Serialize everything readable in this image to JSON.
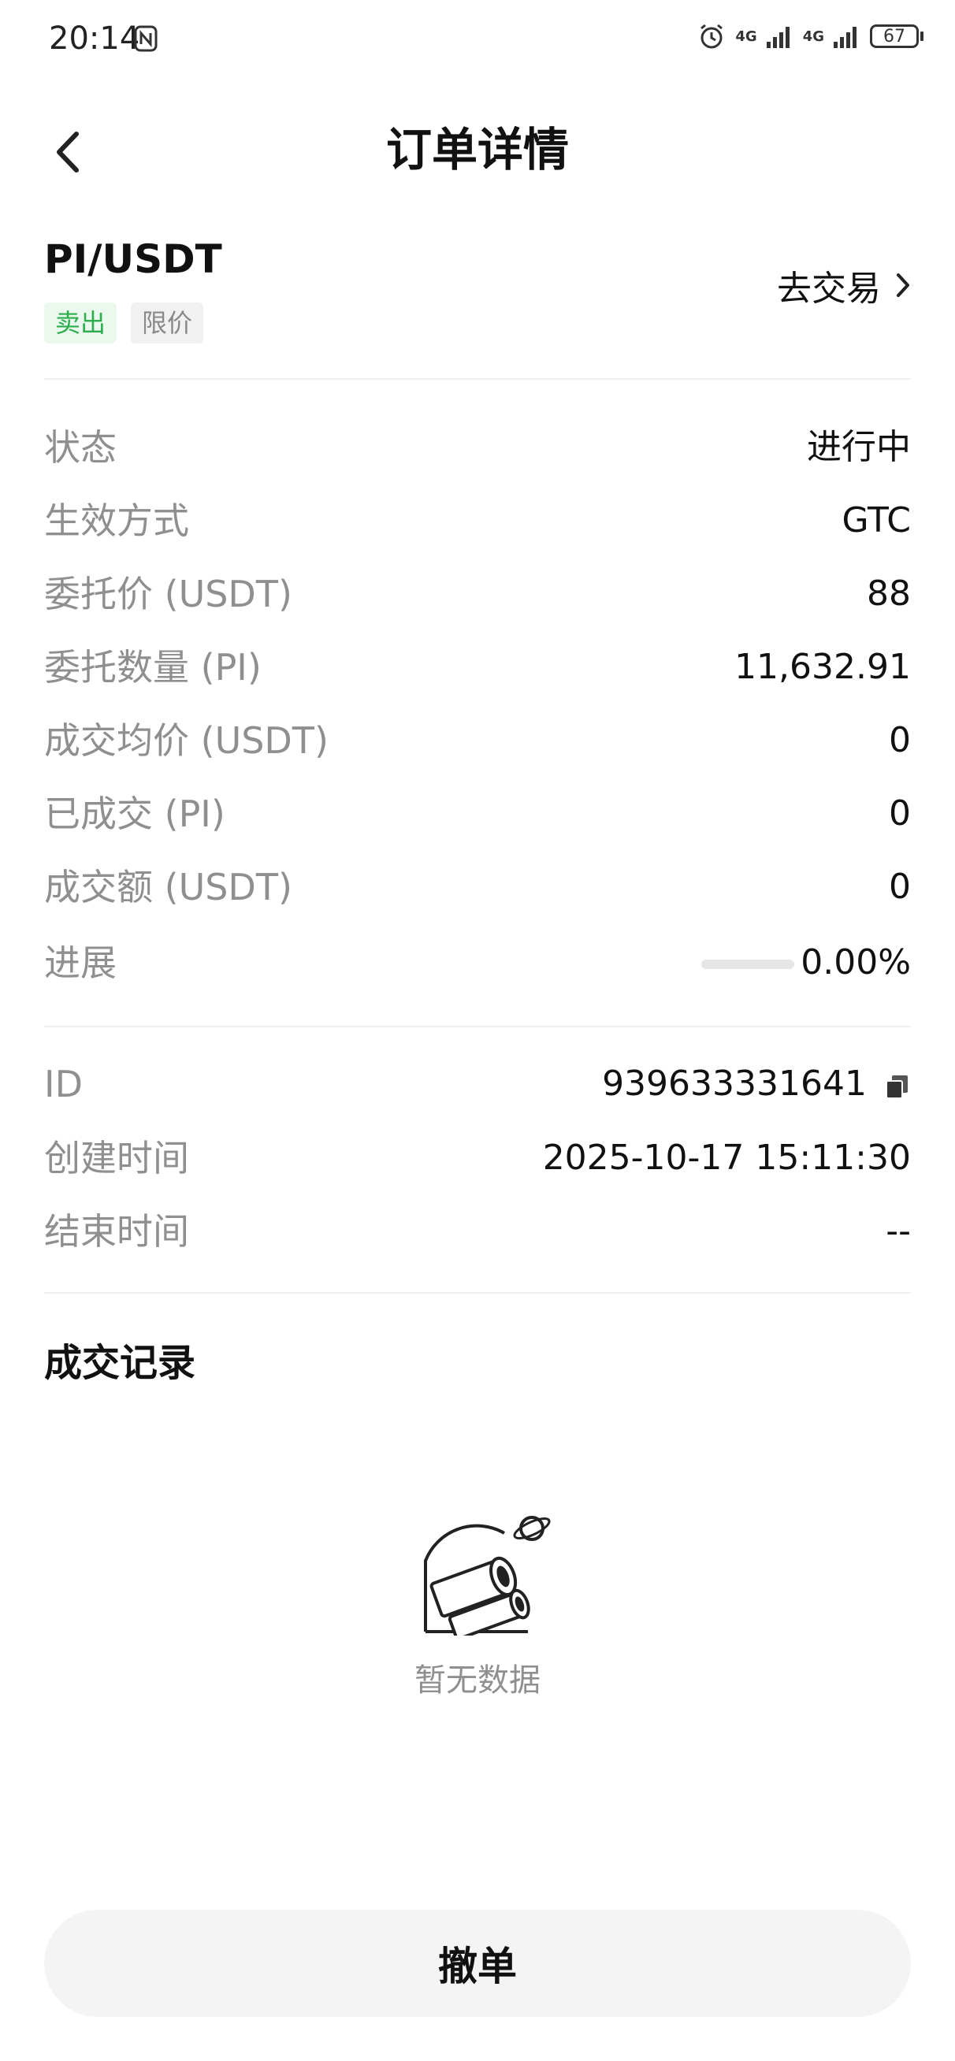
{
  "status_bar": {
    "time": "20:14",
    "network_1": "4G",
    "network_2": "4G",
    "battery": "67"
  },
  "header": {
    "title": "订单详情"
  },
  "order": {
    "pair": "PI/USDT",
    "side_tag": "卖出",
    "type_tag": "限价",
    "trade_link": "去交易"
  },
  "details": [
    {
      "label": "状态",
      "value": "进行中"
    },
    {
      "label": "生效方式",
      "value": "GTC"
    },
    {
      "label": "委托价 (USDT)",
      "value": "88"
    },
    {
      "label": "委托数量 (PI)",
      "value": "11,632.91"
    },
    {
      "label": "成交均价 (USDT)",
      "value": "0"
    },
    {
      "label": "已成交 (PI)",
      "value": "0"
    },
    {
      "label": "成交额 (USDT)",
      "value": "0"
    },
    {
      "label": "进展",
      "value": "0.00%",
      "progress": 0.0
    }
  ],
  "meta": [
    {
      "label": "ID",
      "value": "939633331641"
    },
    {
      "label": "创建时间",
      "value": "2025-10-17 15:11:30"
    },
    {
      "label": "结束时间",
      "value": "--"
    }
  ],
  "records": {
    "title": "成交记录",
    "empty_text": "暂无数据"
  },
  "actions": {
    "cancel_label": "撤单"
  },
  "colors": {
    "sell_green": "#2cae4d",
    "label_gray": "#8f8f8f",
    "button_bg": "#f4f4f4"
  }
}
